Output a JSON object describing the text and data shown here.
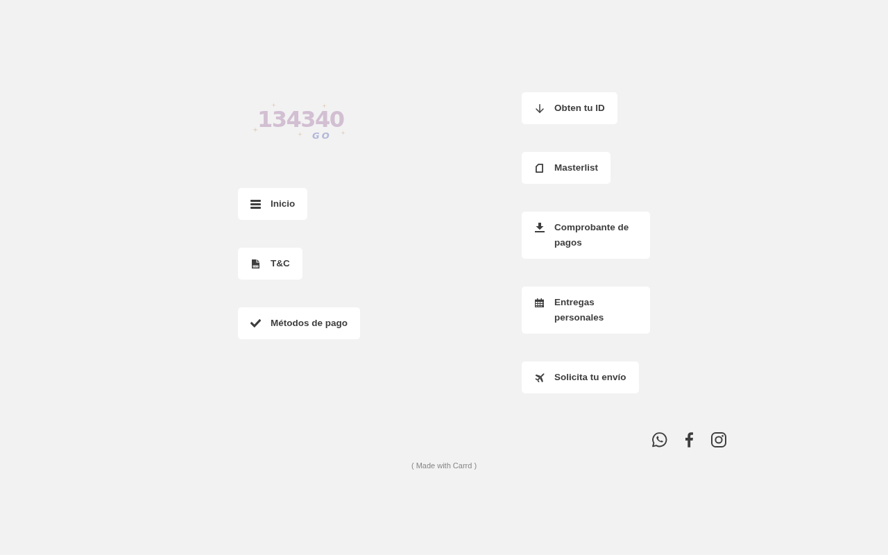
{
  "left_column": {
    "logo": {
      "title": "134340",
      "subtitle": "GO"
    },
    "buttons": [
      {
        "label": "Inicio",
        "kind": "menu"
      },
      {
        "label": "T&C",
        "kind": "file"
      },
      {
        "label": "Métodos de pago",
        "kind": "check"
      }
    ]
  },
  "right_column": {
    "buttons": [
      {
        "label": "Obten tu ID",
        "kind": "arrow"
      },
      {
        "label": "Masterlist",
        "kind": "document"
      },
      {
        "label": "Comprobante de pagos",
        "kind": "tray"
      },
      {
        "label": "Entregas personales",
        "kind": "calendar"
      },
      {
        "label": "Solicita tu envío",
        "kind": "plane"
      }
    ]
  },
  "social_links": [
    {
      "kind": "whatsapp"
    },
    {
      "kind": "facebook"
    },
    {
      "kind": "instagram"
    }
  ],
  "footer": {
    "credit": "( Made with Carrd )"
  }
}
